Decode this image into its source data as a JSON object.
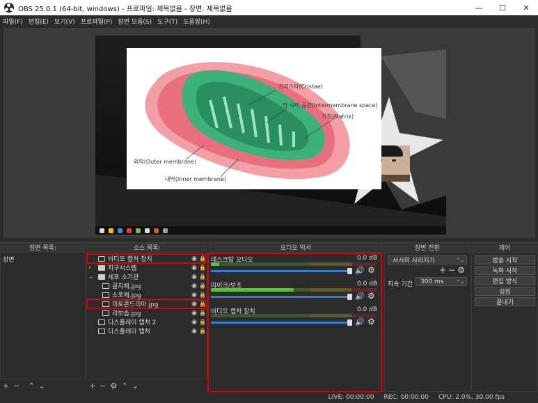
{
  "window": {
    "title": "OBS 25.0.1 (64-bit, windows) - 프로파일: 제목없음 - 장면: 제목없음",
    "minimize": "—",
    "maximize": "☐",
    "close": "✕"
  },
  "menu": [
    "파일(F)",
    "편집(E)",
    "보기(V)",
    "프로파일(P)",
    "장면 모음(S)",
    "도구(T)",
    "도움말(H)"
  ],
  "preview": {
    "slide_labels": {
      "cristae": "크리스타(Cristae)",
      "intermembrane": "막 사이 공간(Intermembrane space)",
      "matrix": "기질(Matrix)",
      "outer": "외막(Outer membrane)",
      "inner": "내막(Inner membrane)"
    }
  },
  "docks": {
    "scenes": {
      "title": "장면 목록:",
      "items": [
        "장면"
      ]
    },
    "sources": {
      "title": "소스 목록:",
      "items": [
        {
          "label": "비디오 캡처 장치",
          "icon": "camera-icon",
          "indent": 0
        },
        {
          "label": "지구시스템",
          "icon": "folder-icon",
          "indent": 0,
          "expand": "›"
        },
        {
          "label": "세포 소기관",
          "icon": "folder-icon",
          "indent": 0,
          "expand": "⌄"
        },
        {
          "label": "골지체.jpg",
          "icon": "image-icon",
          "indent": 1
        },
        {
          "label": "소포체.jpg",
          "icon": "image-icon",
          "indent": 1
        },
        {
          "label": "미토콘드리아.jpg",
          "icon": "image-icon",
          "indent": 1
        },
        {
          "label": "리보솜.jpg",
          "icon": "image-icon",
          "indent": 1
        },
        {
          "label": "디스플레이 캡처 2",
          "icon": "monitor-icon",
          "indent": 0
        },
        {
          "label": "디스플레이 캡처",
          "icon": "monitor-icon",
          "indent": 0
        }
      ]
    },
    "mixer": {
      "title": "오디오 믹서",
      "channels": [
        {
          "name": "데스크탑 오디오",
          "db": "0.0 dB",
          "level": 0.05
        },
        {
          "name": "마이크/보조",
          "db": "0.0 dB",
          "level": 0.5
        },
        {
          "name": "비디오 캡처 장치",
          "db": "0.0 dB",
          "level": 0.0
        }
      ]
    },
    "transitions": {
      "title": "장면 전환",
      "type": "서서히 사라지기",
      "duration_label": "지속 기간",
      "duration": "300 ms"
    },
    "controls": {
      "title": "제어",
      "buttons": [
        "방송 시작",
        "녹화 시작",
        "편집 방식",
        "설정",
        "끝내기"
      ]
    }
  },
  "status": {
    "live": "LIVE: 00:00:00",
    "rec": "REC: 00:00:00",
    "cpu": "CPU: 2.0%, 30.00 fps"
  },
  "colors": {
    "highlight": "#e00000",
    "meter_green": "#59c33d",
    "slider_blue": "#2e7fd6"
  }
}
